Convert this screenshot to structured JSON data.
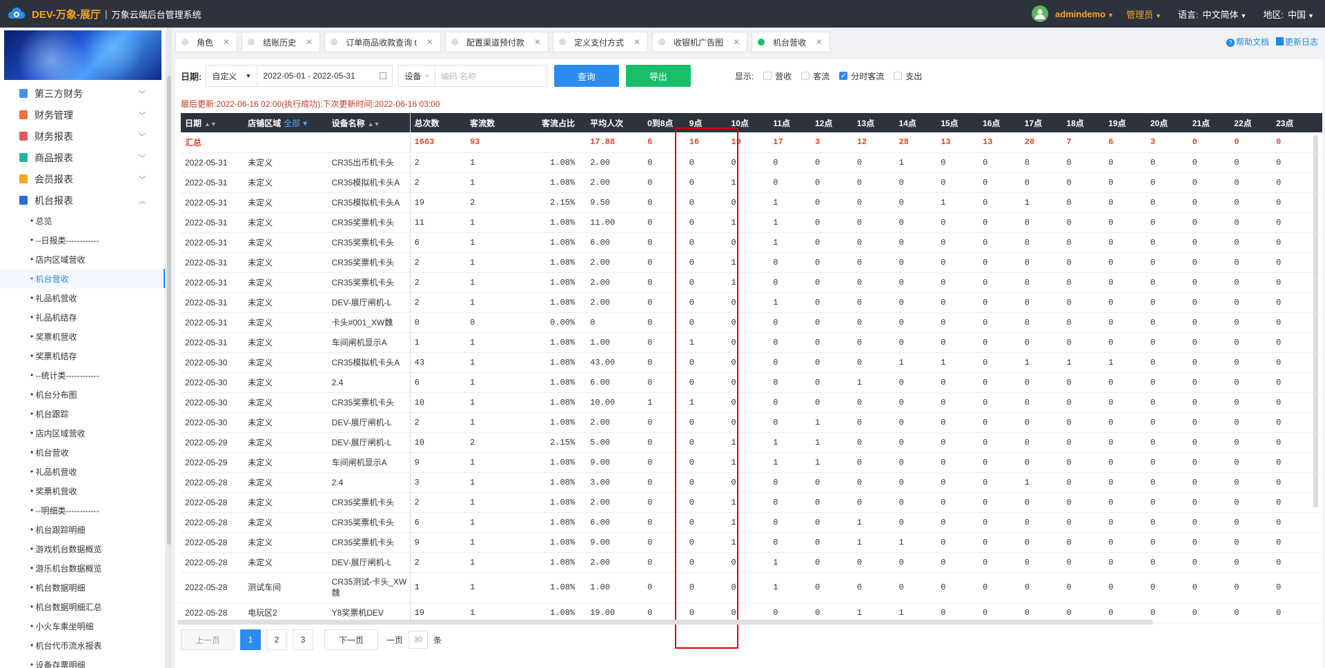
{
  "app": {
    "title": "DEV-万象-展厅",
    "subtitle": "万象云端后台管理系统"
  },
  "topbar": {
    "user": "admindemo",
    "role": "管理员",
    "lang_label": "语言:",
    "lang_value": "中文简体",
    "region_label": "地区:",
    "region_value": "中国"
  },
  "sidebar": {
    "menus": [
      {
        "label": "第三方财务",
        "color": "#4a90e2"
      },
      {
        "label": "财务管理",
        "color": "#e8743b"
      },
      {
        "label": "财务报表",
        "color": "#e05a5a"
      },
      {
        "label": "商品报表",
        "color": "#22b59b"
      },
      {
        "label": "会员报表",
        "color": "#f5a623"
      },
      {
        "label": "机台报表",
        "color": "#2d6bd6"
      }
    ],
    "sub_items": [
      "总览",
      "--日报类------------",
      "店内区域营收",
      "机台营收",
      "礼品机营收",
      "礼品机结存",
      "奖票机营收",
      "奖票机结存",
      "--统计类------------",
      "机台分布图",
      "机台跟踪",
      "店内区域营收",
      "机台营收",
      "礼品机营收",
      "奖票机营收",
      "--明细类------------",
      "机台跟踪明细",
      "游戏机台数据概览",
      "游乐机台数据概览",
      "机台数据明细",
      "机台数据明细汇总",
      "小火车乘坐明细",
      "机台代币流水报表",
      "设备存票明细"
    ],
    "active_index": 3
  },
  "tabs": [
    {
      "label": "角色",
      "active": false
    },
    {
      "label": "结账历史",
      "active": false
    },
    {
      "label": "订单商品收款查询 t",
      "active": false
    },
    {
      "label": "配置渠道预付款",
      "active": false
    },
    {
      "label": "定义支付方式",
      "active": false
    },
    {
      "label": "收银机广告图",
      "active": false
    },
    {
      "label": "机台营收",
      "active": true
    }
  ],
  "tab_links": {
    "help": "帮助文档",
    "changelog": "更新日志"
  },
  "filters": {
    "date_label": "日期:",
    "date_mode": "自定义",
    "date_range": "2022-05-01 - 2022-05-31",
    "device_select": "设备",
    "device_placeholder": "编码 名称",
    "query_label": "查询",
    "export_label": "导出",
    "show_label": "显示:",
    "checkboxes": [
      {
        "label": "营收",
        "checked": false
      },
      {
        "label": "客流",
        "checked": false
      },
      {
        "label": "分时客流",
        "checked": true
      },
      {
        "label": "支出",
        "checked": false
      }
    ]
  },
  "update_info": "最后更新:2022-06-16 02:00(执行成功);下次更新时间:2022-06-16 03:00",
  "table": {
    "headers": {
      "date": "日期",
      "area": "店铺区域",
      "area_filter": "全部",
      "device": "设备名称",
      "count": "总次数",
      "flow": "客流数",
      "ratio": "客流占比",
      "avg": "平均人次"
    },
    "hour_headers": [
      "0到8点",
      "9点",
      "10点",
      "11点",
      "12点",
      "13点",
      "14点",
      "15点",
      "16点",
      "17点",
      "18点",
      "19点",
      "20点",
      "21点",
      "22点",
      "23点"
    ],
    "summary": {
      "label": "汇总",
      "count": "1663",
      "flow": "93",
      "ratio": "",
      "avg": "17.88",
      "hours": [
        "6",
        "16",
        "19",
        "17",
        "3",
        "12",
        "28",
        "13",
        "13",
        "20",
        "7",
        "6",
        "3",
        "0",
        "0",
        "0"
      ]
    },
    "rows": [
      {
        "date": "2022-05-31",
        "area": "未定义",
        "device": "CR35出币机卡头",
        "count": "2",
        "flow": "1",
        "ratio": "1.08%",
        "avg": "2.00",
        "hours": [
          "0",
          "0",
          "0",
          "0",
          "0",
          "0",
          "1",
          "0",
          "0",
          "0",
          "0",
          "0",
          "0",
          "0",
          "0",
          "0"
        ]
      },
      {
        "date": "2022-05-31",
        "area": "未定义",
        "device": "CR35模拟机卡头A",
        "count": "2",
        "flow": "1",
        "ratio": "1.08%",
        "avg": "2.00",
        "hours": [
          "0",
          "0",
          "1",
          "0",
          "0",
          "0",
          "0",
          "0",
          "0",
          "0",
          "0",
          "0",
          "0",
          "0",
          "0",
          "0"
        ]
      },
      {
        "date": "2022-05-31",
        "area": "未定义",
        "device": "CR35模拟机卡头A",
        "count": "19",
        "flow": "2",
        "ratio": "2.15%",
        "avg": "9.50",
        "hours": [
          "0",
          "0",
          "0",
          "1",
          "0",
          "0",
          "0",
          "1",
          "0",
          "1",
          "0",
          "0",
          "0",
          "0",
          "0",
          "0"
        ]
      },
      {
        "date": "2022-05-31",
        "area": "未定义",
        "device": "CR35奖票机卡头",
        "count": "11",
        "flow": "1",
        "ratio": "1.08%",
        "avg": "11.00",
        "hours": [
          "0",
          "0",
          "1",
          "1",
          "0",
          "0",
          "0",
          "0",
          "0",
          "0",
          "0",
          "0",
          "0",
          "0",
          "0",
          "0"
        ]
      },
      {
        "date": "2022-05-31",
        "area": "未定义",
        "device": "CR35奖票机卡头",
        "count": "6",
        "flow": "1",
        "ratio": "1.08%",
        "avg": "6.00",
        "hours": [
          "0",
          "0",
          "0",
          "1",
          "0",
          "0",
          "0",
          "0",
          "0",
          "0",
          "0",
          "0",
          "0",
          "0",
          "0",
          "0"
        ]
      },
      {
        "date": "2022-05-31",
        "area": "未定义",
        "device": "CR35奖票机卡头",
        "count": "2",
        "flow": "1",
        "ratio": "1.08%",
        "avg": "2.00",
        "hours": [
          "0",
          "0",
          "1",
          "0",
          "0",
          "0",
          "0",
          "0",
          "0",
          "0",
          "0",
          "0",
          "0",
          "0",
          "0",
          "0"
        ]
      },
      {
        "date": "2022-05-31",
        "area": "未定义",
        "device": "CR35奖票机卡头",
        "count": "2",
        "flow": "1",
        "ratio": "1.08%",
        "avg": "2.00",
        "hours": [
          "0",
          "0",
          "1",
          "0",
          "0",
          "0",
          "0",
          "0",
          "0",
          "0",
          "0",
          "0",
          "0",
          "0",
          "0",
          "0"
        ]
      },
      {
        "date": "2022-05-31",
        "area": "未定义",
        "device": "DEV-展厅闸机-L",
        "count": "2",
        "flow": "1",
        "ratio": "1.08%",
        "avg": "2.00",
        "hours": [
          "0",
          "0",
          "0",
          "1",
          "0",
          "0",
          "0",
          "0",
          "0",
          "0",
          "0",
          "0",
          "0",
          "0",
          "0",
          "0"
        ]
      },
      {
        "date": "2022-05-31",
        "area": "未定义",
        "device": "卡头#001_XW魏",
        "count": "0",
        "flow": "0",
        "ratio": "0.00%",
        "avg": "0",
        "hours": [
          "0",
          "0",
          "0",
          "0",
          "0",
          "0",
          "0",
          "0",
          "0",
          "0",
          "0",
          "0",
          "0",
          "0",
          "0",
          "0"
        ]
      },
      {
        "date": "2022-05-31",
        "area": "未定义",
        "device": "车间闸机显示A",
        "count": "1",
        "flow": "1",
        "ratio": "1.08%",
        "avg": "1.00",
        "hours": [
          "0",
          "1",
          "0",
          "0",
          "0",
          "0",
          "0",
          "0",
          "0",
          "0",
          "0",
          "0",
          "0",
          "0",
          "0",
          "0"
        ]
      },
      {
        "date": "2022-05-30",
        "area": "未定义",
        "device": "CR35模拟机卡头A",
        "count": "43",
        "flow": "1",
        "ratio": "1.08%",
        "avg": "43.00",
        "hours": [
          "0",
          "0",
          "0",
          "0",
          "0",
          "0",
          "1",
          "1",
          "0",
          "1",
          "1",
          "1",
          "0",
          "0",
          "0",
          "0"
        ]
      },
      {
        "date": "2022-05-30",
        "area": "未定义",
        "device": "2.4",
        "count": "6",
        "flow": "1",
        "ratio": "1.08%",
        "avg": "6.00",
        "hours": [
          "0",
          "0",
          "0",
          "0",
          "0",
          "1",
          "0",
          "0",
          "0",
          "0",
          "0",
          "0",
          "0",
          "0",
          "0",
          "0"
        ]
      },
      {
        "date": "2022-05-30",
        "area": "未定义",
        "device": "CR35奖票机卡头",
        "count": "10",
        "flow": "1",
        "ratio": "1.08%",
        "avg": "10.00",
        "hours": [
          "1",
          "1",
          "0",
          "0",
          "0",
          "0",
          "0",
          "0",
          "0",
          "0",
          "0",
          "0",
          "0",
          "0",
          "0",
          "0"
        ]
      },
      {
        "date": "2022-05-30",
        "area": "未定义",
        "device": "DEV-展厅闸机-L",
        "count": "2",
        "flow": "1",
        "ratio": "1.08%",
        "avg": "2.00",
        "hours": [
          "0",
          "0",
          "0",
          "0",
          "1",
          "0",
          "0",
          "0",
          "0",
          "0",
          "0",
          "0",
          "0",
          "0",
          "0",
          "0"
        ]
      },
      {
        "date": "2022-05-29",
        "area": "未定义",
        "device": "DEV-展厅闸机-L",
        "count": "10",
        "flow": "2",
        "ratio": "2.15%",
        "avg": "5.00",
        "hours": [
          "0",
          "0",
          "1",
          "1",
          "1",
          "0",
          "0",
          "0",
          "0",
          "0",
          "0",
          "0",
          "0",
          "0",
          "0",
          "0"
        ]
      },
      {
        "date": "2022-05-29",
        "area": "未定义",
        "device": "车间闸机显示A",
        "count": "9",
        "flow": "1",
        "ratio": "1.08%",
        "avg": "9.00",
        "hours": [
          "0",
          "0",
          "1",
          "1",
          "1",
          "0",
          "0",
          "0",
          "0",
          "0",
          "0",
          "0",
          "0",
          "0",
          "0",
          "0"
        ]
      },
      {
        "date": "2022-05-28",
        "area": "未定义",
        "device": "2.4",
        "count": "3",
        "flow": "1",
        "ratio": "1.08%",
        "avg": "3.00",
        "hours": [
          "0",
          "0",
          "0",
          "0",
          "0",
          "0",
          "0",
          "0",
          "0",
          "1",
          "0",
          "0",
          "0",
          "0",
          "0",
          "0"
        ]
      },
      {
        "date": "2022-05-28",
        "area": "未定义",
        "device": "CR35奖票机卡头",
        "count": "2",
        "flow": "1",
        "ratio": "1.08%",
        "avg": "2.00",
        "hours": [
          "0",
          "0",
          "1",
          "0",
          "0",
          "0",
          "0",
          "0",
          "0",
          "0",
          "0",
          "0",
          "0",
          "0",
          "0",
          "0"
        ]
      },
      {
        "date": "2022-05-28",
        "area": "未定义",
        "device": "CR35奖票机卡头",
        "count": "6",
        "flow": "1",
        "ratio": "1.08%",
        "avg": "6.00",
        "hours": [
          "0",
          "0",
          "1",
          "0",
          "0",
          "1",
          "0",
          "0",
          "0",
          "0",
          "0",
          "0",
          "0",
          "0",
          "0",
          "0"
        ]
      },
      {
        "date": "2022-05-28",
        "area": "未定义",
        "device": "CR35奖票机卡头",
        "count": "9",
        "flow": "1",
        "ratio": "1.08%",
        "avg": "9.00",
        "hours": [
          "0",
          "0",
          "1",
          "0",
          "0",
          "1",
          "1",
          "0",
          "0",
          "0",
          "0",
          "0",
          "0",
          "0",
          "0",
          "0"
        ]
      },
      {
        "date": "2022-05-28",
        "area": "未定义",
        "device": "DEV-展厅闸机-L",
        "count": "2",
        "flow": "1",
        "ratio": "1.08%",
        "avg": "2.00",
        "hours": [
          "0",
          "0",
          "0",
          "1",
          "0",
          "0",
          "0",
          "0",
          "0",
          "0",
          "0",
          "0",
          "0",
          "0",
          "0",
          "0"
        ]
      },
      {
        "date": "2022-05-28",
        "area": "测试车间",
        "device": "CR35测试-卡头_XW魏",
        "count": "1",
        "flow": "1",
        "ratio": "1.08%",
        "avg": "1.00",
        "hours": [
          "0",
          "0",
          "0",
          "1",
          "0",
          "0",
          "0",
          "0",
          "0",
          "0",
          "0",
          "0",
          "0",
          "0",
          "0",
          "0"
        ],
        "tall": true
      },
      {
        "date": "2022-05-28",
        "area": "电玩区2",
        "device": "Y8奖票机DEV",
        "count": "19",
        "flow": "1",
        "ratio": "1.08%",
        "avg": "19.00",
        "hours": [
          "0",
          "0",
          "0",
          "0",
          "0",
          "1",
          "1",
          "0",
          "0",
          "0",
          "0",
          "0",
          "0",
          "0",
          "0",
          "0"
        ]
      }
    ]
  },
  "pager": {
    "prev": "上一页",
    "next": "下一页",
    "pages": [
      "1",
      "2",
      "3"
    ],
    "active": "1",
    "per_page_label": "一页",
    "per_page": "30",
    "unit": "条"
  }
}
